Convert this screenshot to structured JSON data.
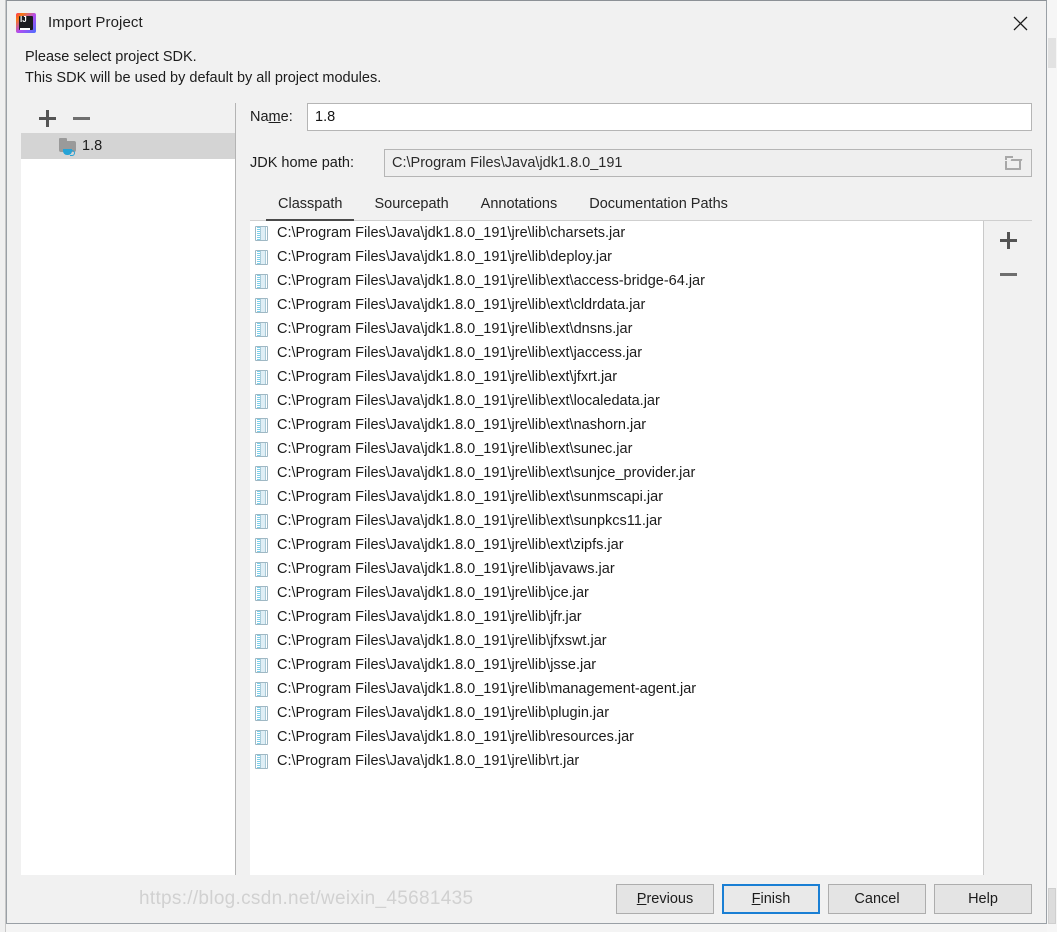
{
  "window": {
    "title": "Import Project",
    "icon": "intellij-idea-logo",
    "close_label": "✕"
  },
  "description": {
    "line1": "Please select project SDK.",
    "line2": "This SDK will be used by default by all project modules."
  },
  "sidebar": {
    "toolbar": {
      "add_label": "+",
      "remove_label": "−"
    },
    "items": [
      {
        "label": "1.8",
        "icon": "java-sdk-folder-icon",
        "selected": true
      }
    ]
  },
  "fields": {
    "name": {
      "label_pre": "Na",
      "label_mnemonic": "m",
      "label_post": "e:",
      "value": "1.8"
    },
    "jdk_home_path": {
      "label": "JDK home path:",
      "value": "C:\\Program Files\\Java\\jdk1.8.0_191",
      "browse_icon": "folder-browse-icon",
      "readonly": true
    }
  },
  "tabs": [
    {
      "label": "Classpath",
      "active": true
    },
    {
      "label": "Sourcepath",
      "active": false
    },
    {
      "label": "Annotations",
      "active": false
    },
    {
      "label": "Documentation Paths",
      "active": false
    }
  ],
  "classpath": {
    "side_toolbar": {
      "add_label": "+",
      "remove_label": "−",
      "remove_disabled": true
    },
    "entries": [
      "C:\\Program Files\\Java\\jdk1.8.0_191\\jre\\lib\\charsets.jar",
      "C:\\Program Files\\Java\\jdk1.8.0_191\\jre\\lib\\deploy.jar",
      "C:\\Program Files\\Java\\jdk1.8.0_191\\jre\\lib\\ext\\access-bridge-64.jar",
      "C:\\Program Files\\Java\\jdk1.8.0_191\\jre\\lib\\ext\\cldrdata.jar",
      "C:\\Program Files\\Java\\jdk1.8.0_191\\jre\\lib\\ext\\dnsns.jar",
      "C:\\Program Files\\Java\\jdk1.8.0_191\\jre\\lib\\ext\\jaccess.jar",
      "C:\\Program Files\\Java\\jdk1.8.0_191\\jre\\lib\\ext\\jfxrt.jar",
      "C:\\Program Files\\Java\\jdk1.8.0_191\\jre\\lib\\ext\\localedata.jar",
      "C:\\Program Files\\Java\\jdk1.8.0_191\\jre\\lib\\ext\\nashorn.jar",
      "C:\\Program Files\\Java\\jdk1.8.0_191\\jre\\lib\\ext\\sunec.jar",
      "C:\\Program Files\\Java\\jdk1.8.0_191\\jre\\lib\\ext\\sunjce_provider.jar",
      "C:\\Program Files\\Java\\jdk1.8.0_191\\jre\\lib\\ext\\sunmscapi.jar",
      "C:\\Program Files\\Java\\jdk1.8.0_191\\jre\\lib\\ext\\sunpkcs11.jar",
      "C:\\Program Files\\Java\\jdk1.8.0_191\\jre\\lib\\ext\\zipfs.jar",
      "C:\\Program Files\\Java\\jdk1.8.0_191\\jre\\lib\\javaws.jar",
      "C:\\Program Files\\Java\\jdk1.8.0_191\\jre\\lib\\jce.jar",
      "C:\\Program Files\\Java\\jdk1.8.0_191\\jre\\lib\\jfr.jar",
      "C:\\Program Files\\Java\\jdk1.8.0_191\\jre\\lib\\jfxswt.jar",
      "C:\\Program Files\\Java\\jdk1.8.0_191\\jre\\lib\\jsse.jar",
      "C:\\Program Files\\Java\\jdk1.8.0_191\\jre\\lib\\management-agent.jar",
      "C:\\Program Files\\Java\\jdk1.8.0_191\\jre\\lib\\plugin.jar",
      "C:\\Program Files\\Java\\jdk1.8.0_191\\jre\\lib\\resources.jar",
      "C:\\Program Files\\Java\\jdk1.8.0_191\\jre\\lib\\rt.jar"
    ]
  },
  "footer": {
    "buttons": [
      {
        "pre": "",
        "mn": "P",
        "post": "revious",
        "default": false,
        "name": "previous-button"
      },
      {
        "pre": "",
        "mn": "F",
        "post": "inish",
        "default": true,
        "name": "finish-button"
      },
      {
        "pre": "Cancel",
        "mn": "",
        "post": "",
        "default": false,
        "name": "cancel-button"
      },
      {
        "pre": "Help",
        "mn": "",
        "post": "",
        "default": false,
        "name": "help-button"
      }
    ]
  },
  "watermark": "https://blog.csdn.net/weixin_45681435",
  "colors": {
    "dialog_bg": "#f1f1f1",
    "selection": "#d4d4d4",
    "focus_border": "#1a7fd4",
    "jar_icon": "#64c8e8",
    "sdk_cup": "#26a3d6"
  }
}
